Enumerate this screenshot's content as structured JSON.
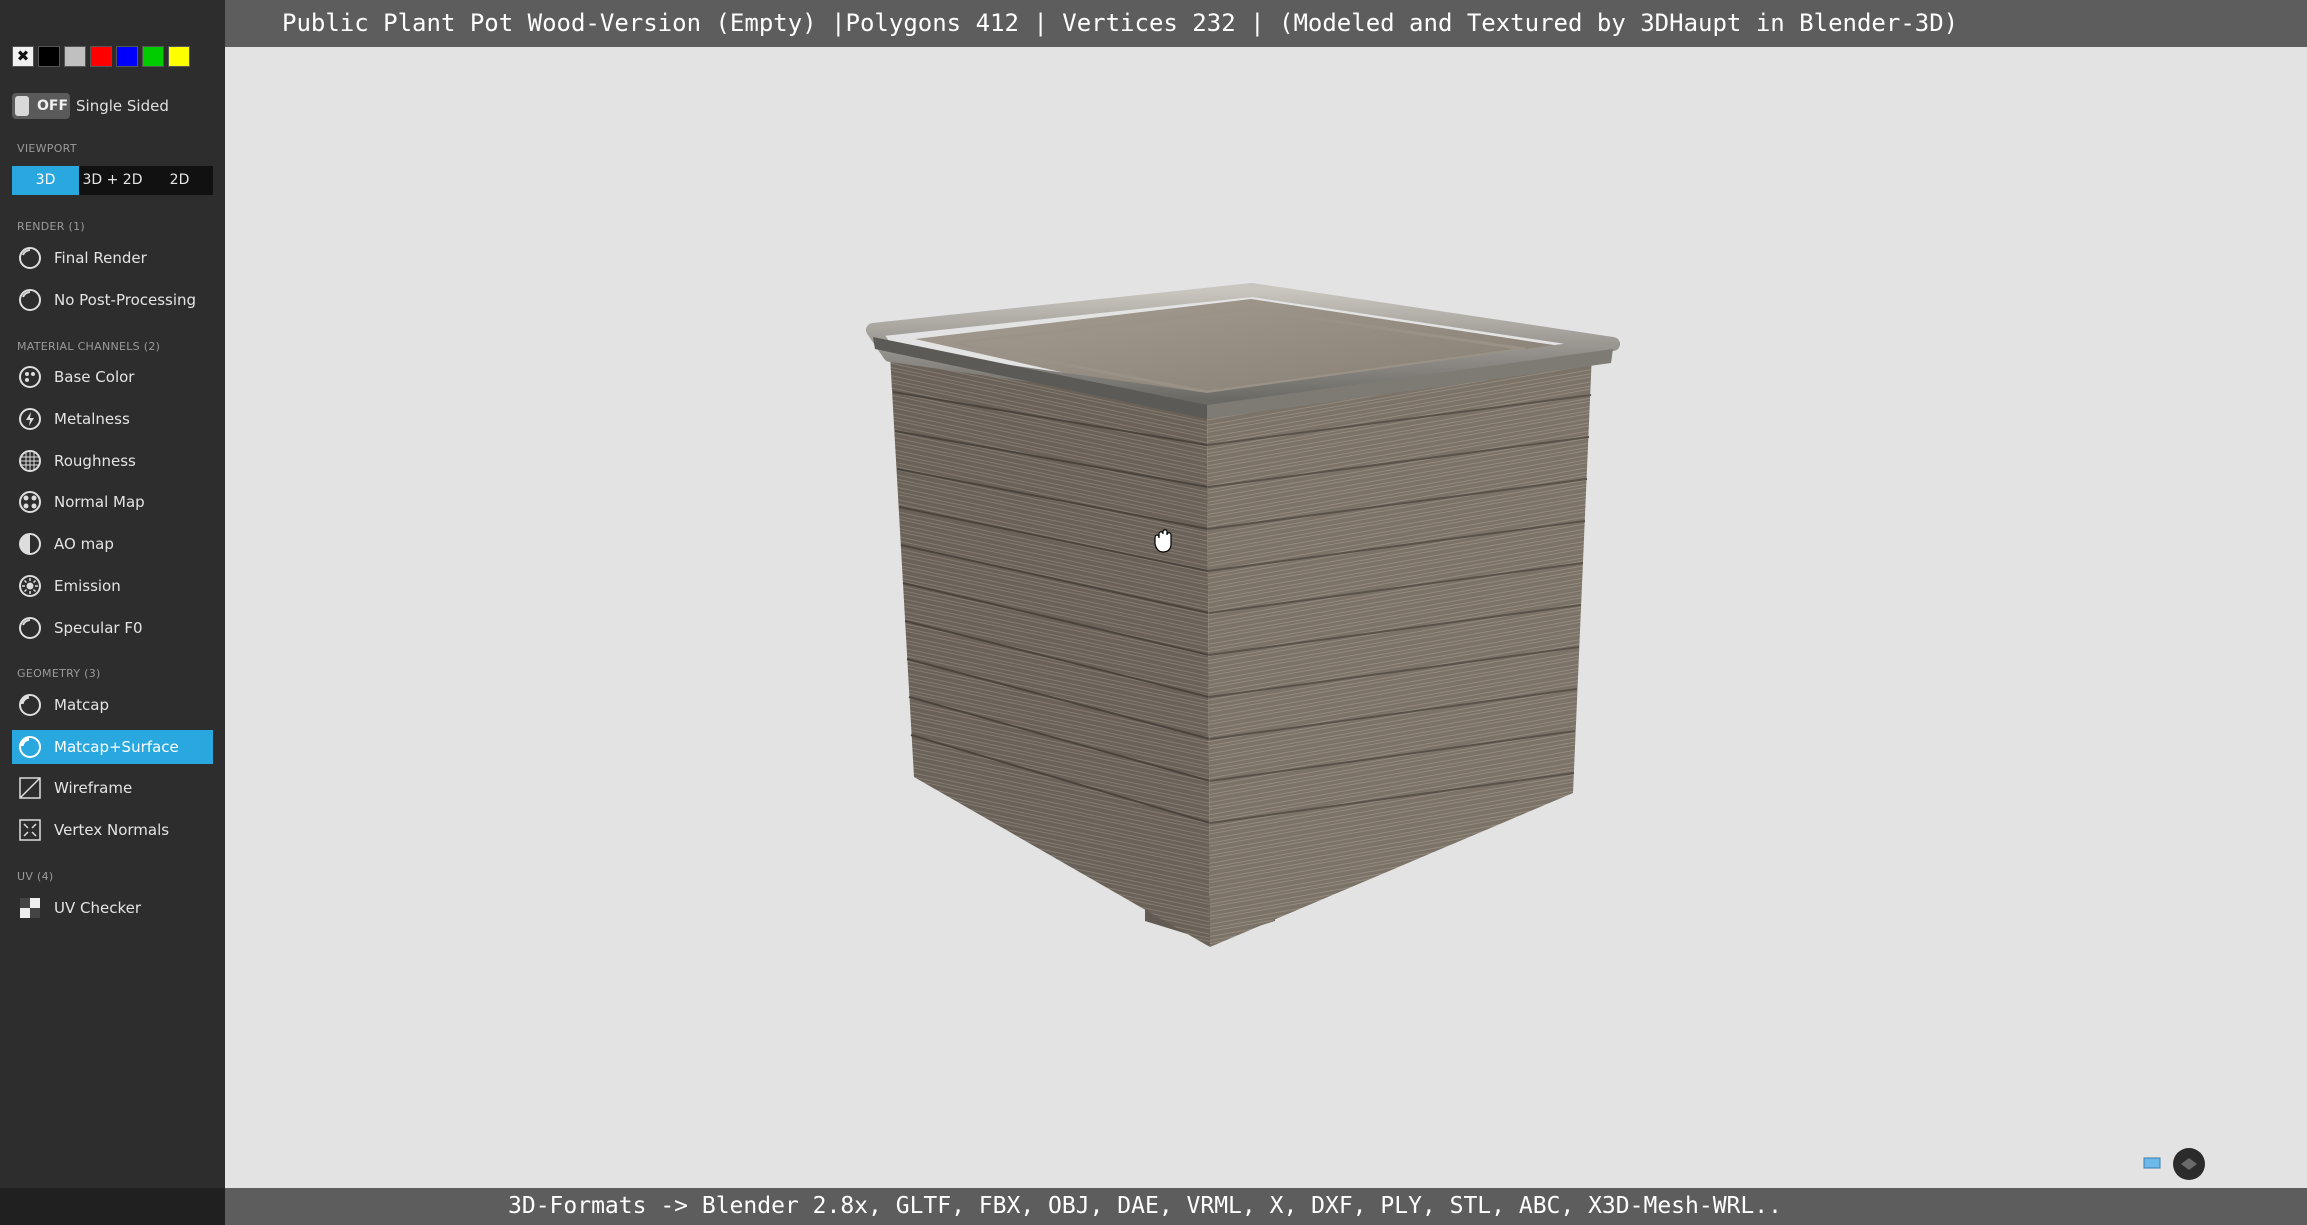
{
  "title_bar": {
    "text": "Public Plant Pot Wood-Version (Empty) |Polygons 412 | Vertices 232 | (Modeled and Textured by 3DHaupt in Blender-3D)"
  },
  "bottom_bar": {
    "text": "3D-Formats -> Blender 2.8x, GLTF, FBX, OBJ, DAE, VRML, X, DXF, PLY, STL, ABC, X3D-Mesh-WRL.."
  },
  "sidebar": {
    "wireframe_swatches": [
      {
        "name": "none",
        "color": "#f2f2f2"
      },
      {
        "name": "black",
        "color": "#000000"
      },
      {
        "name": "gray",
        "color": "#c0c0c0"
      },
      {
        "name": "red",
        "color": "#ff0000"
      },
      {
        "name": "blue",
        "color": "#0000ff"
      },
      {
        "name": "green",
        "color": "#00cc00"
      },
      {
        "name": "yellow",
        "color": "#ffff00"
      }
    ],
    "single_sided": {
      "state": "OFF",
      "label": "Single Sided"
    },
    "viewport": {
      "section": "VIEWPORT",
      "options": [
        "3D",
        "3D + 2D",
        "2D"
      ],
      "selected": "3D"
    },
    "render": {
      "section": "RENDER (1)",
      "items": [
        {
          "label": "Final Render",
          "icon": "circle-icon"
        },
        {
          "label": "No Post-Processing",
          "icon": "circle-icon"
        }
      ]
    },
    "material": {
      "section": "MATERIAL CHANNELS (2)",
      "items": [
        {
          "label": "Base Color",
          "icon": "palette-icon"
        },
        {
          "label": "Metalness",
          "icon": "bolt-icon"
        },
        {
          "label": "Roughness",
          "icon": "grid-circle-icon"
        },
        {
          "label": "Normal Map",
          "icon": "normal-map-icon"
        },
        {
          "label": "AO map",
          "icon": "half-circle-icon"
        },
        {
          "label": "Emission",
          "icon": "sun-icon"
        },
        {
          "label": "Specular F0",
          "icon": "circle-icon"
        }
      ]
    },
    "geometry": {
      "section": "GEOMETRY (3)",
      "items": [
        {
          "label": "Matcap",
          "icon": "matcap-icon"
        },
        {
          "label": "Matcap+Surface",
          "icon": "matcap-icon",
          "active": true
        },
        {
          "label": "Wireframe",
          "icon": "wireframe-icon"
        },
        {
          "label": "Vertex Normals",
          "icon": "vertex-normals-icon"
        }
      ]
    },
    "uv": {
      "section": "UV (4)",
      "items": [
        {
          "label": "UV Checker",
          "icon": "checker-icon"
        }
      ]
    }
  },
  "colors": {
    "accent": "#29a8e0",
    "sidebar_bg": "#2d2d2d",
    "viewport_bg": "#e3e3e3",
    "bar_bg": "#5d5d5d"
  }
}
